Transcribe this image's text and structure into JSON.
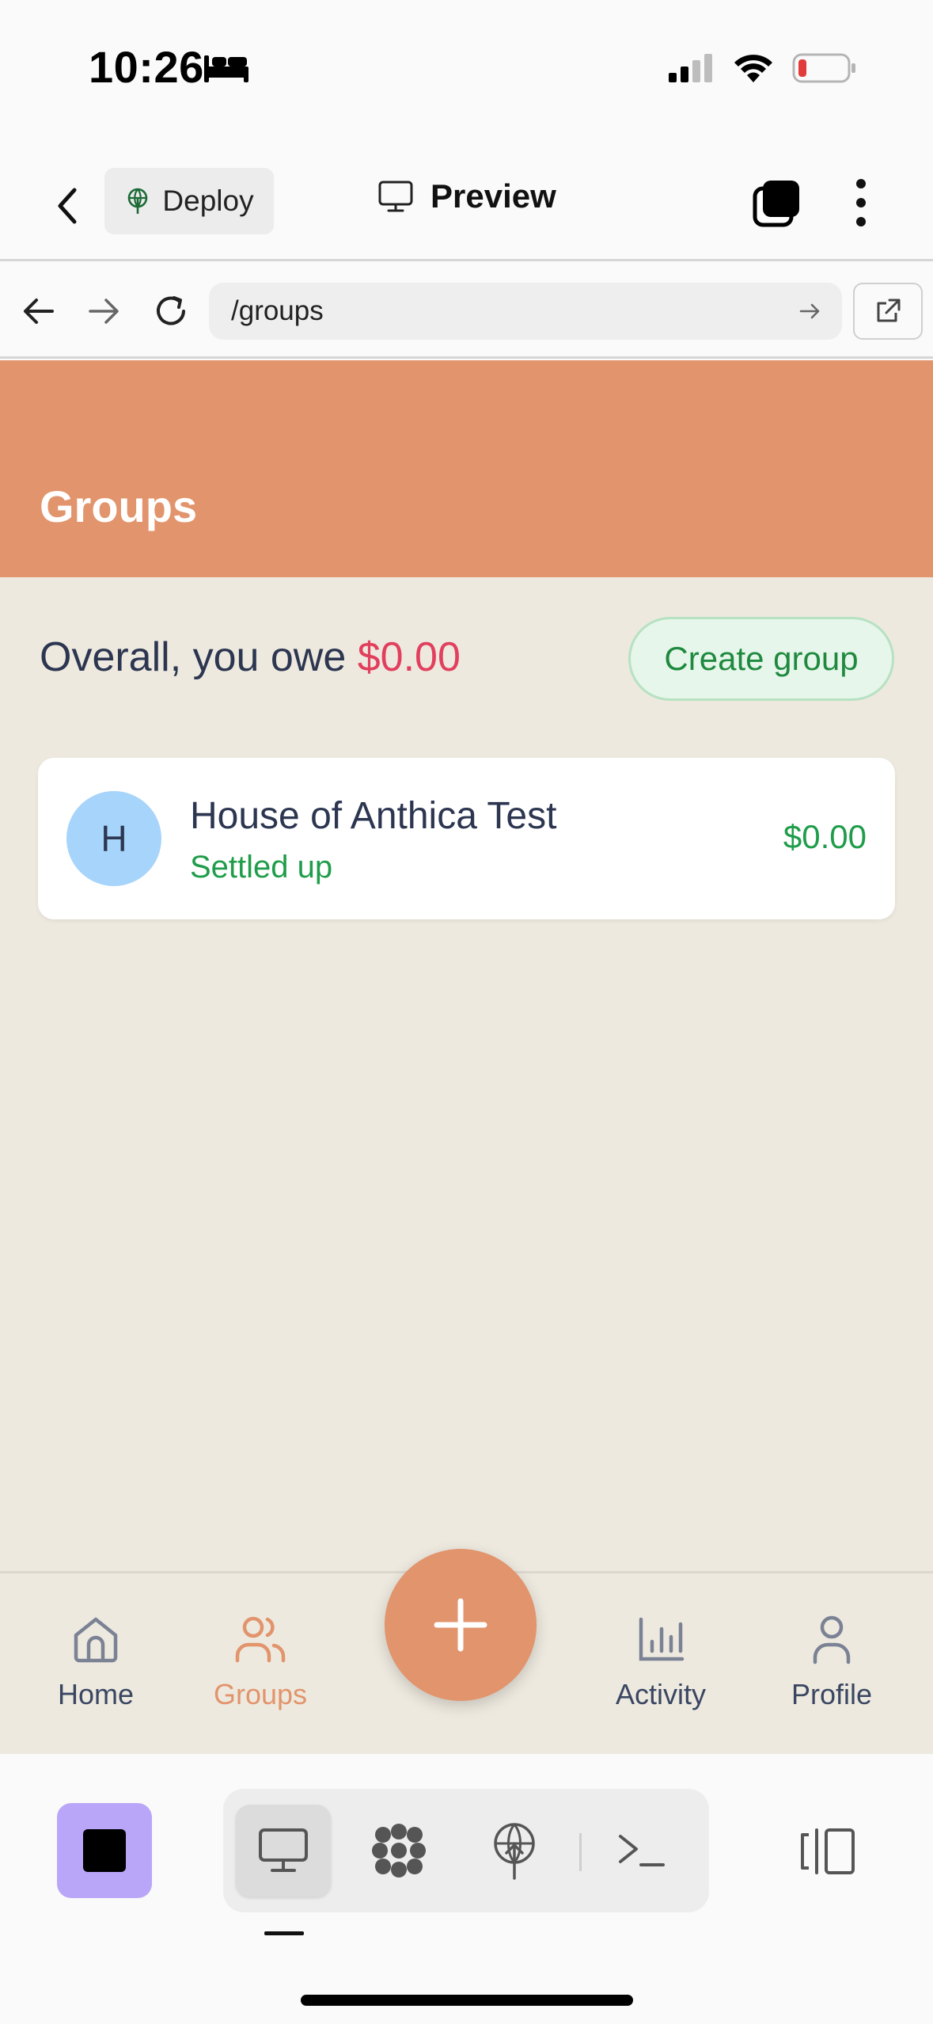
{
  "status_bar": {
    "time": "10:26"
  },
  "app_bar": {
    "deploy_label": "Deploy",
    "preview_label": "Preview"
  },
  "browser": {
    "url": "/groups"
  },
  "page": {
    "title": "Groups",
    "summary_prefix": "Overall, you owe ",
    "summary_amount": "$0.00",
    "create_group_label": "Create group"
  },
  "groups": [
    {
      "initial": "H",
      "name": "House of Anthica Test",
      "status": "Settled up",
      "amount": "$0.00"
    }
  ],
  "bottom_nav": {
    "home": "Home",
    "groups": "Groups",
    "activity": "Activity",
    "profile": "Profile",
    "active": "groups"
  },
  "colors": {
    "accent": "#e2946c",
    "background": "#ede9df",
    "owe_red": "#e23f5d",
    "settled_green": "#1f9d4a",
    "avatar_blue": "#a7d4fb",
    "stop_purple": "#b9a6f8"
  },
  "icons": [
    "bed-icon",
    "signal-icon",
    "wifi-icon",
    "battery-icon",
    "chevron-left-icon",
    "deploy-icon",
    "monitor-icon",
    "tabs-icon",
    "more-vertical-icon",
    "arrow-left-icon",
    "arrow-right-icon",
    "refresh-icon",
    "open-external-icon",
    "home-icon",
    "users-icon",
    "plus-icon",
    "bar-chart-icon",
    "user-icon",
    "stop-icon",
    "workspace-icon",
    "deploy-tool-icon",
    "terminal-icon",
    "side-panel-icon"
  ]
}
